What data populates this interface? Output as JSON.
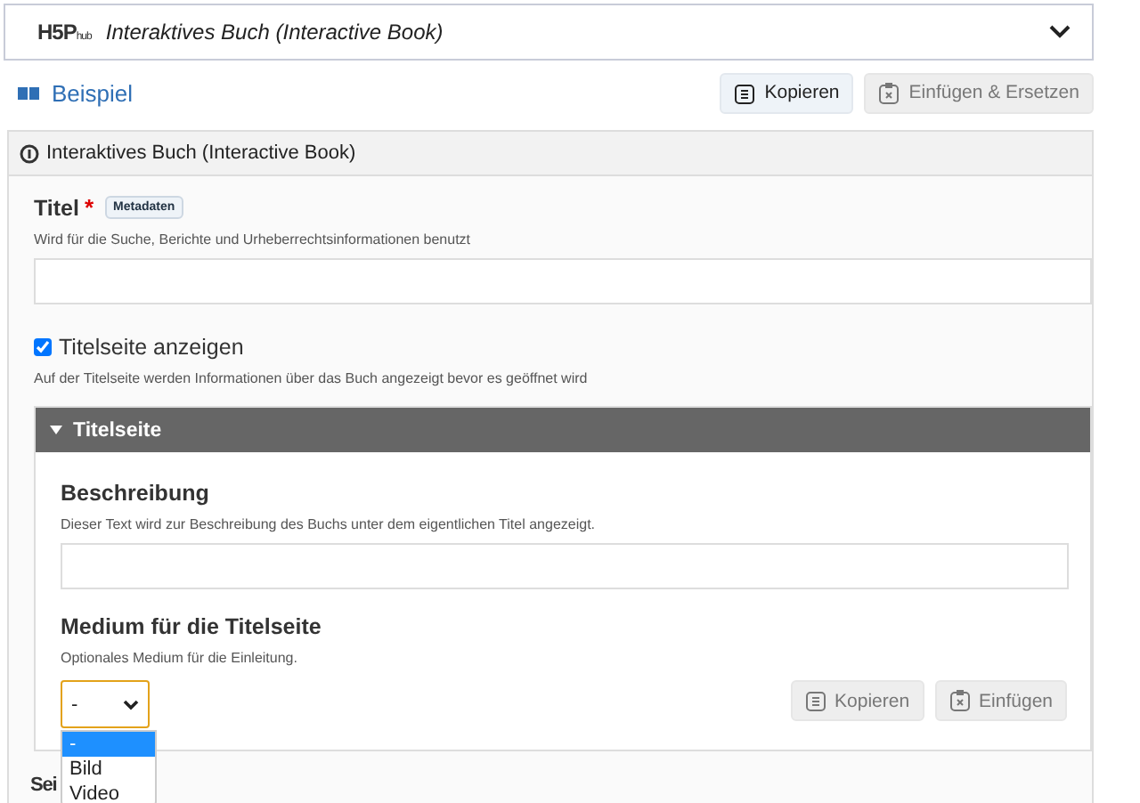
{
  "hub_bar": {
    "logo": "H5P",
    "logo_suffix": "hub",
    "title": "Interaktives Buch (Interactive Book)",
    "expanded": false
  },
  "example": {
    "label": "Beispiel"
  },
  "toolbar": [
    {
      "label": "Kopieren",
      "disabled": false
    },
    {
      "label": "Einfügen & Ersetzen",
      "disabled": true
    }
  ],
  "panel": {
    "title": "Interaktives Buch (Interactive Book)",
    "title_field": {
      "label": "Titel",
      "required": true,
      "required_mark": "*",
      "tag": "Metadaten",
      "description": "Wird für die Suche, Berichte und Urheberrechtsinformationen benutzt"
    },
    "cover_toggle": {
      "label": "Titelseite anzeigen",
      "checked": true,
      "description": "Auf der Titelseite werden Informationen über das Buch angezeigt bevor es geöffnet wird"
    },
    "cover_group": {
      "title": "Titelseite",
      "expanded": true,
      "description_field": {
        "label": "Beschreibung",
        "description": "Dieser Text wird zur Beschreibung des Buchs unter dem eigentlichen Titel angezeigt."
      },
      "media_field": {
        "label": "Medium für die Titelseite",
        "description": "Optionales Medium für die Einleitung.",
        "value": "-",
        "options": [
          {
            "label": "-",
            "selected": true
          },
          {
            "label": "Bild",
            "selected": false
          },
          {
            "label": "Video",
            "selected": false
          }
        ],
        "buttons": [
          {
            "label": "Kopieren",
            "disabled": true
          },
          {
            "label": "Einfügen",
            "disabled": true
          }
        ]
      }
    },
    "next_label": "Sei"
  }
}
